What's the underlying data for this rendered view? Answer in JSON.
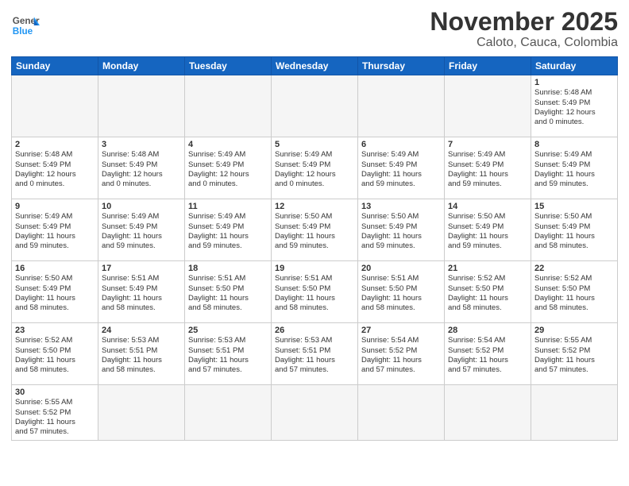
{
  "logo": {
    "general": "General",
    "blue": "Blue"
  },
  "header": {
    "month": "November 2025",
    "location": "Caloto, Cauca, Colombia"
  },
  "weekdays": [
    "Sunday",
    "Monday",
    "Tuesday",
    "Wednesday",
    "Thursday",
    "Friday",
    "Saturday"
  ],
  "weeks": [
    [
      {
        "day": "",
        "info": ""
      },
      {
        "day": "",
        "info": ""
      },
      {
        "day": "",
        "info": ""
      },
      {
        "day": "",
        "info": ""
      },
      {
        "day": "",
        "info": ""
      },
      {
        "day": "",
        "info": ""
      },
      {
        "day": "1",
        "info": "Sunrise: 5:48 AM\nSunset: 5:49 PM\nDaylight: 12 hours\nand 0 minutes."
      }
    ],
    [
      {
        "day": "2",
        "info": "Sunrise: 5:48 AM\nSunset: 5:49 PM\nDaylight: 12 hours\nand 0 minutes."
      },
      {
        "day": "3",
        "info": "Sunrise: 5:48 AM\nSunset: 5:49 PM\nDaylight: 12 hours\nand 0 minutes."
      },
      {
        "day": "4",
        "info": "Sunrise: 5:49 AM\nSunset: 5:49 PM\nDaylight: 12 hours\nand 0 minutes."
      },
      {
        "day": "5",
        "info": "Sunrise: 5:49 AM\nSunset: 5:49 PM\nDaylight: 12 hours\nand 0 minutes."
      },
      {
        "day": "6",
        "info": "Sunrise: 5:49 AM\nSunset: 5:49 PM\nDaylight: 11 hours\nand 59 minutes."
      },
      {
        "day": "7",
        "info": "Sunrise: 5:49 AM\nSunset: 5:49 PM\nDaylight: 11 hours\nand 59 minutes."
      },
      {
        "day": "8",
        "info": "Sunrise: 5:49 AM\nSunset: 5:49 PM\nDaylight: 11 hours\nand 59 minutes."
      }
    ],
    [
      {
        "day": "9",
        "info": "Sunrise: 5:49 AM\nSunset: 5:49 PM\nDaylight: 11 hours\nand 59 minutes."
      },
      {
        "day": "10",
        "info": "Sunrise: 5:49 AM\nSunset: 5:49 PM\nDaylight: 11 hours\nand 59 minutes."
      },
      {
        "day": "11",
        "info": "Sunrise: 5:49 AM\nSunset: 5:49 PM\nDaylight: 11 hours\nand 59 minutes."
      },
      {
        "day": "12",
        "info": "Sunrise: 5:50 AM\nSunset: 5:49 PM\nDaylight: 11 hours\nand 59 minutes."
      },
      {
        "day": "13",
        "info": "Sunrise: 5:50 AM\nSunset: 5:49 PM\nDaylight: 11 hours\nand 59 minutes."
      },
      {
        "day": "14",
        "info": "Sunrise: 5:50 AM\nSunset: 5:49 PM\nDaylight: 11 hours\nand 59 minutes."
      },
      {
        "day": "15",
        "info": "Sunrise: 5:50 AM\nSunset: 5:49 PM\nDaylight: 11 hours\nand 58 minutes."
      }
    ],
    [
      {
        "day": "16",
        "info": "Sunrise: 5:50 AM\nSunset: 5:49 PM\nDaylight: 11 hours\nand 58 minutes."
      },
      {
        "day": "17",
        "info": "Sunrise: 5:51 AM\nSunset: 5:49 PM\nDaylight: 11 hours\nand 58 minutes."
      },
      {
        "day": "18",
        "info": "Sunrise: 5:51 AM\nSunset: 5:50 PM\nDaylight: 11 hours\nand 58 minutes."
      },
      {
        "day": "19",
        "info": "Sunrise: 5:51 AM\nSunset: 5:50 PM\nDaylight: 11 hours\nand 58 minutes."
      },
      {
        "day": "20",
        "info": "Sunrise: 5:51 AM\nSunset: 5:50 PM\nDaylight: 11 hours\nand 58 minutes."
      },
      {
        "day": "21",
        "info": "Sunrise: 5:52 AM\nSunset: 5:50 PM\nDaylight: 11 hours\nand 58 minutes."
      },
      {
        "day": "22",
        "info": "Sunrise: 5:52 AM\nSunset: 5:50 PM\nDaylight: 11 hours\nand 58 minutes."
      }
    ],
    [
      {
        "day": "23",
        "info": "Sunrise: 5:52 AM\nSunset: 5:50 PM\nDaylight: 11 hours\nand 58 minutes."
      },
      {
        "day": "24",
        "info": "Sunrise: 5:53 AM\nSunset: 5:51 PM\nDaylight: 11 hours\nand 58 minutes."
      },
      {
        "day": "25",
        "info": "Sunrise: 5:53 AM\nSunset: 5:51 PM\nDaylight: 11 hours\nand 57 minutes."
      },
      {
        "day": "26",
        "info": "Sunrise: 5:53 AM\nSunset: 5:51 PM\nDaylight: 11 hours\nand 57 minutes."
      },
      {
        "day": "27",
        "info": "Sunrise: 5:54 AM\nSunset: 5:52 PM\nDaylight: 11 hours\nand 57 minutes."
      },
      {
        "day": "28",
        "info": "Sunrise: 5:54 AM\nSunset: 5:52 PM\nDaylight: 11 hours\nand 57 minutes."
      },
      {
        "day": "29",
        "info": "Sunrise: 5:55 AM\nSunset: 5:52 PM\nDaylight: 11 hours\nand 57 minutes."
      }
    ],
    [
      {
        "day": "30",
        "info": "Sunrise: 5:55 AM\nSunset: 5:52 PM\nDaylight: 11 hours\nand 57 minutes."
      },
      {
        "day": "",
        "info": ""
      },
      {
        "day": "",
        "info": ""
      },
      {
        "day": "",
        "info": ""
      },
      {
        "day": "",
        "info": ""
      },
      {
        "day": "",
        "info": ""
      },
      {
        "day": "",
        "info": ""
      }
    ]
  ]
}
